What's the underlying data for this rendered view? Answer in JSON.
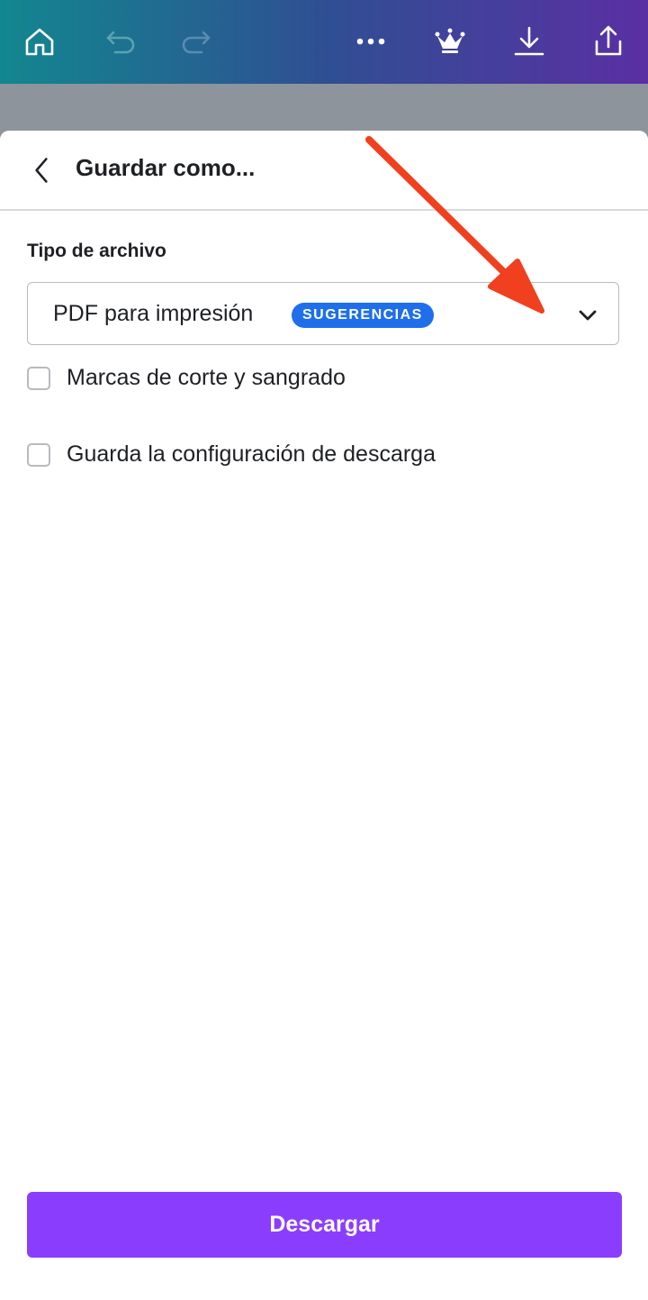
{
  "toolbar": {
    "icons": [
      "home-icon",
      "undo-icon",
      "redo-icon",
      "more-icon",
      "crown-icon",
      "download-icon",
      "share-icon"
    ]
  },
  "sheet": {
    "title": "Guardar como...",
    "file_type_label": "Tipo de archivo",
    "file_type_value": "PDF para impresión",
    "badge": "SUGERENCIAS",
    "options": [
      {
        "label": "Marcas de corte y sangrado",
        "checked": false
      },
      {
        "label": "Guarda la configuración de descarga",
        "checked": false
      }
    ],
    "download_label": "Descargar"
  },
  "colors": {
    "accent": "#8b3dfd",
    "badge": "#1f6fea",
    "annotation_arrow": "#f0401f"
  }
}
